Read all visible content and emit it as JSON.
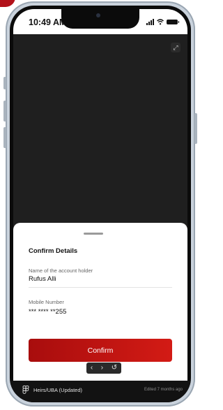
{
  "status": {
    "time": "10:49 AM"
  },
  "sheet": {
    "title": "Confirm Details",
    "fields": [
      {
        "label": "Name of the account holder",
        "value": "Rufus Alli"
      },
      {
        "label": "Mobile Number",
        "value": "*** **** **255"
      }
    ],
    "confirm_label": "Confirm"
  },
  "nav": {
    "prev": "‹",
    "next": "›",
    "restart": "↺"
  },
  "footer": {
    "title": "Heirs/UBA (Updated)",
    "edited": "Edited 7 months ago"
  },
  "colors": {
    "accent": "#c4140f",
    "accent_dark": "#a80d0d",
    "screen_bg": "#1f1f1f"
  },
  "icons": [
    "expand-icon",
    "signal-icon",
    "wifi-icon",
    "battery-icon",
    "figma-icon"
  ]
}
